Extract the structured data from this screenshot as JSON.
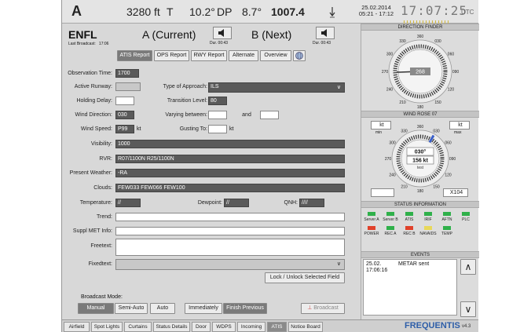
{
  "topbar": {
    "airport": "A",
    "altitude": "3280 ft",
    "temp_label": "T",
    "temp_value": "10.2°",
    "dp_label": "DP",
    "dp_value": "8.7°",
    "qnh": "1007.4",
    "date": "25.02.2014",
    "time_range": "05:21 - 17:12",
    "clock": "17:07:25",
    "utc": "UTC"
  },
  "atis": {
    "station": "ENFL",
    "last_broadcast_label": "Last Broadcast:",
    "last_broadcast_value": "17:06",
    "current_label": "A (Current)",
    "next_label": "B (Next)",
    "dur_current": "Dur. 00:43",
    "dur_next": "Dur. 00:43"
  },
  "tabs": [
    "ATIS Report",
    "OPS Report",
    "RWY Report",
    "Alternate",
    "Overview"
  ],
  "fields": {
    "observation_time_label": "Observation Time:",
    "observation_time": "1700",
    "active_runway_label": "Active Runway:",
    "type_of_approach_label": "Type of Approach:",
    "type_of_approach": "ILS",
    "holding_delay_label": "Holding Delay:",
    "transition_level_label": "Transition Level:",
    "transition_level": "80",
    "wind_direction_label": "Wind Direction:",
    "wind_direction": "030",
    "varying_between_label": "Varying between:",
    "and_label": "and",
    "wind_speed_label": "Wind Speed:",
    "wind_speed": "P99",
    "kt": "kt",
    "gusting_to_label": "Gusting To:",
    "visibility_label": "Visibility:",
    "visibility": "1000",
    "rvr_label": "RVR:",
    "rvr": "R07/1100N R25/1100N",
    "present_weather_label": "Present Weather:",
    "present_weather": "-RA",
    "clouds_label": "Clouds:",
    "clouds": "FEW033 FEW066 FEW100",
    "temperature_label": "Temperature:",
    "temperature": "//",
    "dewpoint_label": "Dewpoint:",
    "dewpoint": "//",
    "qnh_label": "QNH:",
    "qnh": "////",
    "trend_label": "Trend:",
    "suppl_label": "Suppl MET Info:",
    "freetext_label": "Freetext:",
    "fixedtext_label": "Fixedtext:"
  },
  "buttons": {
    "lock_unlock": "Lock / Unlock Selected Field",
    "broadcast_mode_label": "Broadcast Mode:",
    "manual": "Manual",
    "semi_auto": "Semi-Auto",
    "auto": "Auto",
    "immediately": "Immediately",
    "finish_previous": "Finish Previous",
    "broadcast": "Broadcast"
  },
  "direction_finder": {
    "title": "DIRECTION FINDER",
    "bearing": "268",
    "labels": [
      "360",
      "030",
      "060",
      "090",
      "120",
      "150",
      "180",
      "210",
      "240",
      "270",
      "300",
      "330"
    ]
  },
  "wind_rose": {
    "title": "WIND ROSE 07",
    "kt_left": "kt",
    "kt_right": "kt",
    "min": "min",
    "max": "max",
    "direction": "030°",
    "speed": "156 kt",
    "test": "test",
    "crosswind": "X104",
    "labels": [
      "360",
      "030",
      "060",
      "090",
      "120",
      "150",
      "180",
      "210",
      "240",
      "270",
      "300",
      "330"
    ]
  },
  "status": {
    "title": "STATUS INFORMATION",
    "row1": [
      {
        "label": "Server A",
        "color": "#2fb04a"
      },
      {
        "label": "Server B",
        "color": "#2fb04a"
      },
      {
        "label": "ATIS",
        "color": "#2fb04a"
      },
      {
        "label": "IRIF",
        "color": "#2fb04a"
      },
      {
        "label": "AFTN",
        "color": "#2fb04a"
      },
      {
        "label": "PLC",
        "color": "#2fb04a"
      }
    ],
    "row2": [
      {
        "label": "POWER",
        "color": "#e0412a"
      },
      {
        "label": "REC A",
        "color": "#2fb04a"
      },
      {
        "label": "REC B",
        "color": "#e0412a"
      },
      {
        "label": "NAVAIDS",
        "color": "#e8d85a"
      },
      {
        "label": "TEMP",
        "color": "#2fb04a"
      }
    ]
  },
  "events": {
    "title": "EVENTS",
    "date": "25.02.",
    "time": "17:06:16",
    "text": "METAR sent"
  },
  "bottom_tabs": [
    "Airfield",
    "Spot Lights",
    "Curtains",
    "Status Details",
    "Door",
    "WDPS",
    "Incoming",
    "ATIS",
    "Notice Board"
  ],
  "brand": "FREQUENTIS",
  "version": "v4.3"
}
